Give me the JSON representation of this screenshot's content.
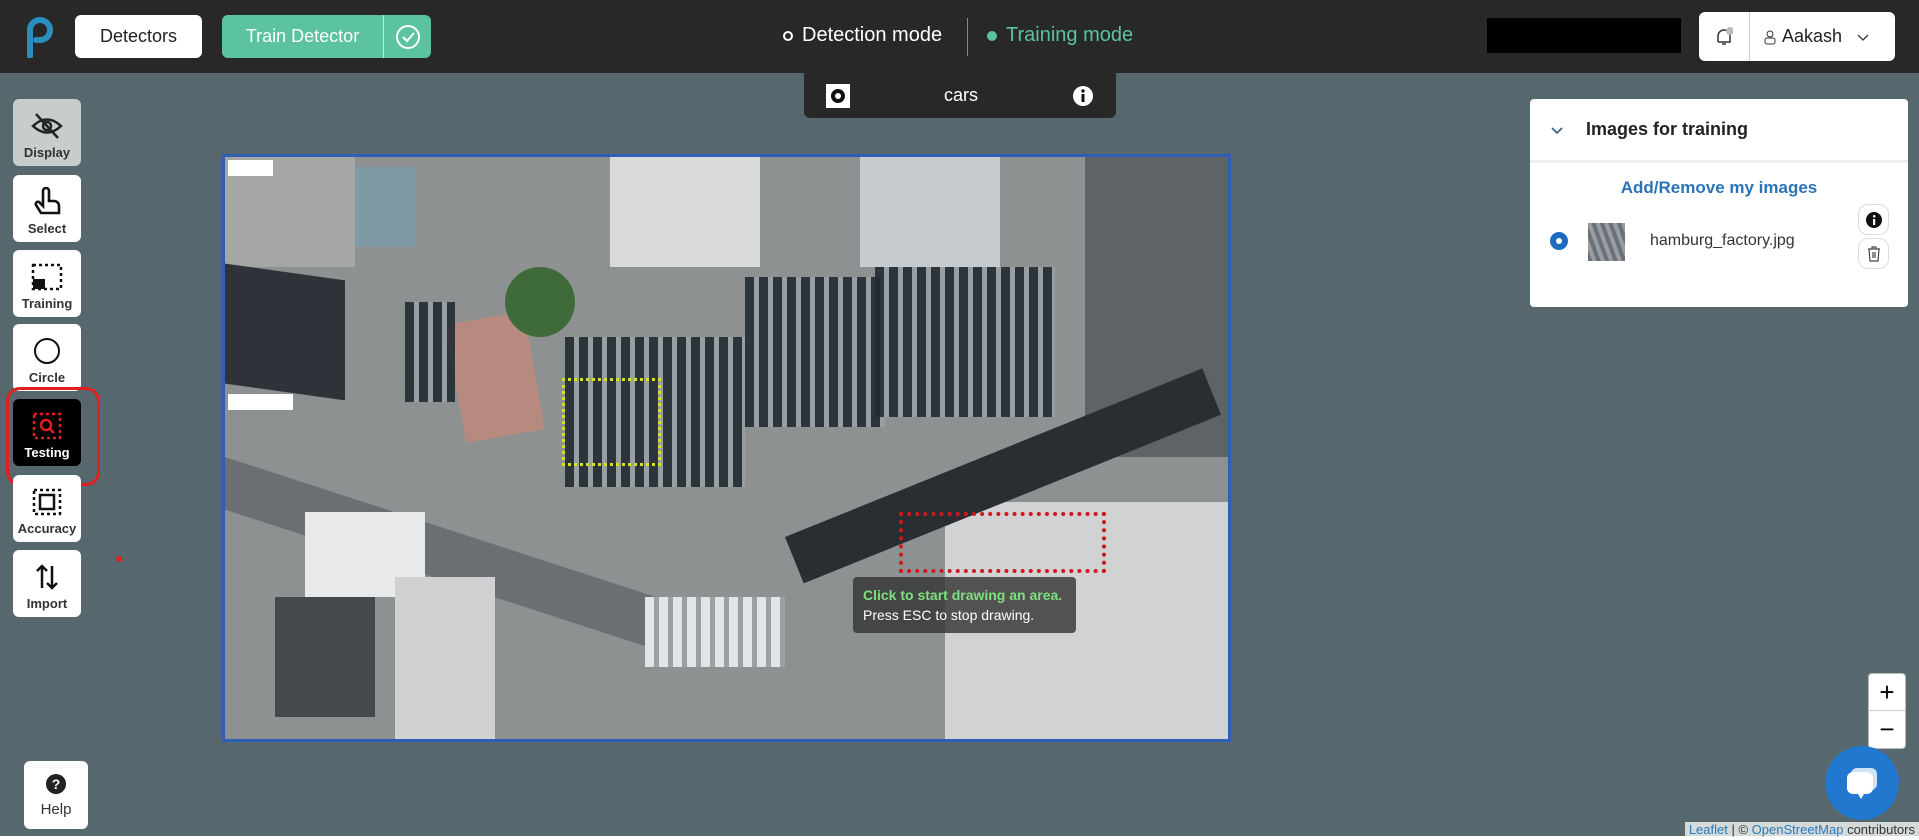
{
  "header": {
    "detectors_label": "Detectors",
    "train_detector_label": "Train Detector",
    "detection_mode_label": "Detection mode",
    "training_mode_label": "Training mode",
    "user_name": "Aakash"
  },
  "category_bar": {
    "name": "cars"
  },
  "sidebar": {
    "items": [
      {
        "label": "Display"
      },
      {
        "label": "Select"
      },
      {
        "label": "Training"
      },
      {
        "label": "Circle"
      },
      {
        "label": "Testing"
      },
      {
        "label": "Accuracy"
      },
      {
        "label": "Import"
      }
    ],
    "help_label": "Help"
  },
  "map": {
    "tooltip_line1": "Click to start drawing an area.",
    "tooltip_line2": "Press ESC to stop drawing.",
    "zoom_in": "+",
    "zoom_out": "−",
    "attribution_leaflet": "Leaflet",
    "attribution_sep": " | © ",
    "attribution_osm": "OpenStreetMap",
    "attribution_tail": " contributors"
  },
  "panel": {
    "title": "Images for training",
    "add_remove_label": "Add/Remove my images",
    "images": [
      {
        "filename": "hamburg_factory.jpg",
        "selected": true
      }
    ]
  },
  "colors": {
    "accent": "#5cc3a0",
    "link": "#2b73b8",
    "background": "#56686d",
    "header": "#282828"
  }
}
